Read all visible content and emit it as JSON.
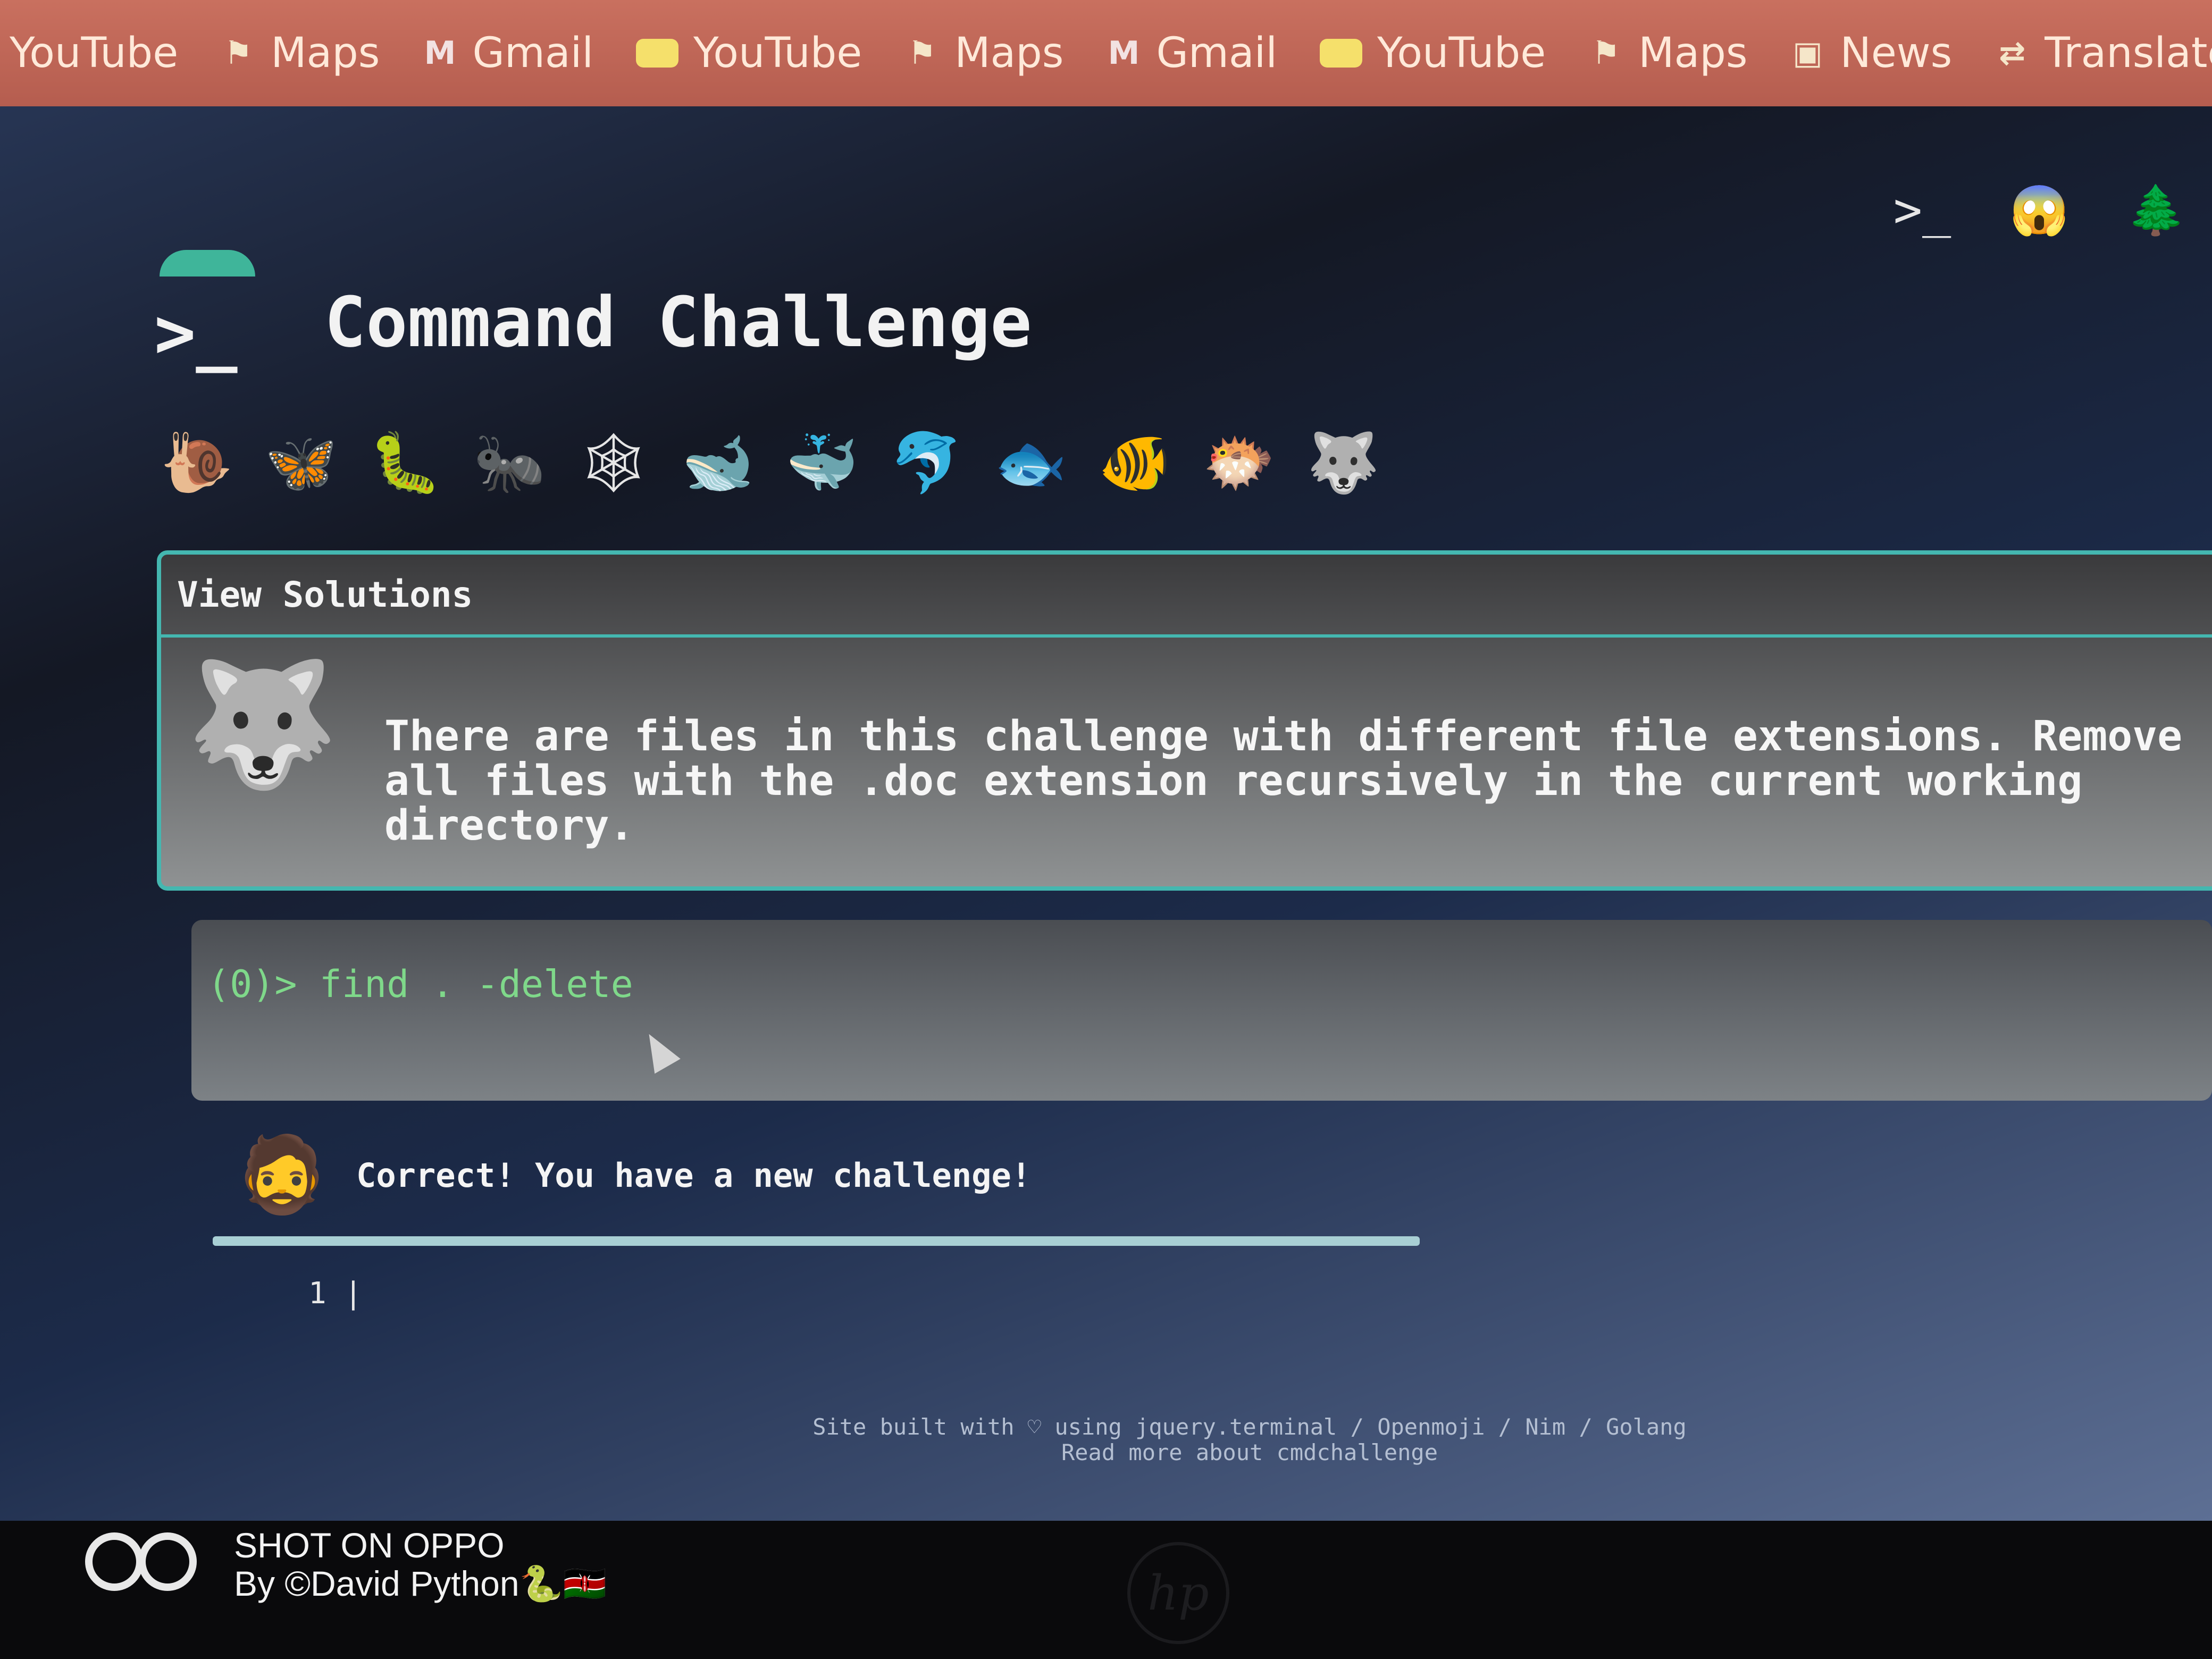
{
  "bookmarks": [
    {
      "label": "YouTube",
      "icon": "none"
    },
    {
      "label": "Maps",
      "icon": "maps-icon"
    },
    {
      "label": "Gmail",
      "icon": "gmail-icon"
    },
    {
      "label": "YouTube",
      "icon": "youtube-icon"
    },
    {
      "label": "Maps",
      "icon": "maps-icon"
    },
    {
      "label": "Gmail",
      "icon": "gmail-icon"
    },
    {
      "label": "YouTube",
      "icon": "youtube-icon"
    },
    {
      "label": "Maps",
      "icon": "maps-icon"
    },
    {
      "label": "News",
      "icon": "news-icon"
    },
    {
      "label": "Translate",
      "icon": "translate-icon"
    }
  ],
  "header": {
    "title": "Command Challenge",
    "logo_glyph": ">_"
  },
  "creatures": [
    "🐌",
    "🦋",
    "🐛",
    "🐜",
    "🕸",
    "🐋",
    "🐳",
    "🐬",
    "🐟",
    "🐠",
    "🐡",
    "🐺"
  ],
  "top_right_icons": [
    ">_",
    "😱",
    "🌲"
  ],
  "solutions": {
    "header": "View Solutions",
    "avatar": "🐺",
    "challenge_text": "There are files in this challenge with different file extensions. Remove all files with the .doc extension recursively in the current working directory."
  },
  "terminal": {
    "line": "(0)> find . -delete"
  },
  "response": {
    "avatar": "🧔",
    "text": "Correct! You have a new challenge!"
  },
  "editor": {
    "line_number": "1",
    "cursor": "|"
  },
  "footer": {
    "line1": "Site built with ♡ using jquery.terminal / Openmoji / Nim / Golang",
    "line2": "Read more about cmdchallenge"
  },
  "watermark": {
    "line1": "SHOT ON OPPO",
    "line2": "By ©David Python🐍🇰🇪"
  },
  "colors": {
    "bookmarks_bar": "#c9705f",
    "panel_border": "#44b7b0",
    "terminal_green": "#7fd88a"
  }
}
